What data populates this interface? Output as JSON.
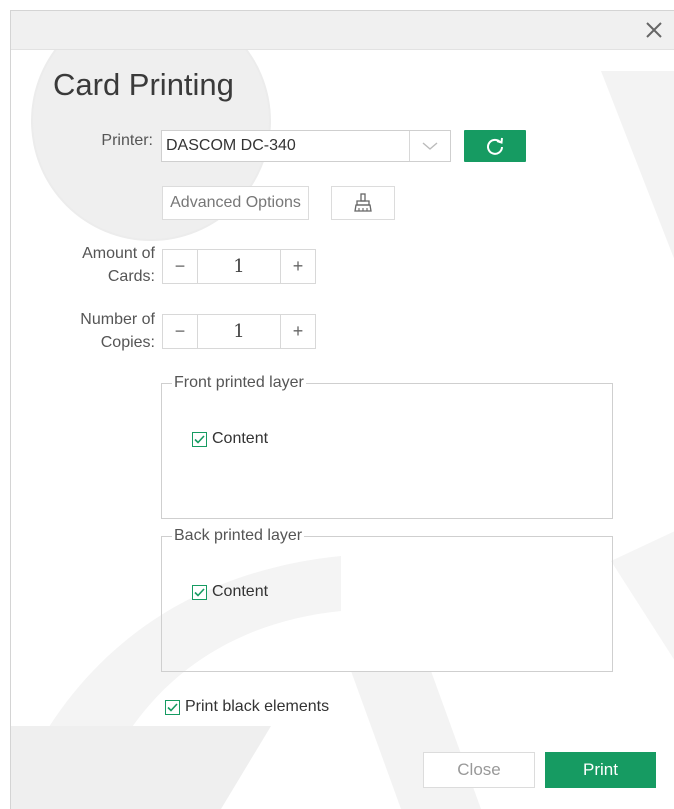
{
  "dialog": {
    "title": "Card Printing",
    "close_icon": "close-icon"
  },
  "printer": {
    "label": "Printer:",
    "selected": "DASCOM DC-340",
    "refresh_icon": "refresh-icon"
  },
  "options": {
    "advanced_label": "Advanced Options",
    "clean_icon": "brush-icon"
  },
  "amount": {
    "label_line1": "Amount of",
    "label_line2": "Cards:",
    "minus": "−",
    "value": "1",
    "plus": "+"
  },
  "copies": {
    "label_line1": "Number of",
    "label_line2": "Copies:",
    "minus": "−",
    "value": "1",
    "plus": "+"
  },
  "front_layer": {
    "legend": "Front printed layer",
    "content_label": "Content",
    "checked": true
  },
  "back_layer": {
    "legend": "Back printed layer",
    "content_label": "Content",
    "checked": true
  },
  "print_black": {
    "label": "Print black elements",
    "checked": true
  },
  "footer": {
    "close_label": "Close",
    "print_label": "Print"
  },
  "colors": {
    "accent": "#169b62",
    "titlebar": "#f0f0f0"
  }
}
